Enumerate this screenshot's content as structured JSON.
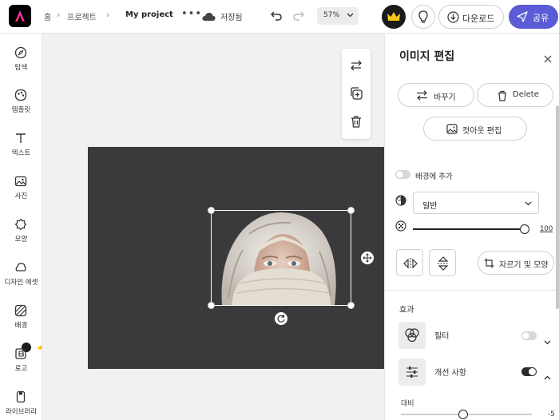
{
  "topbar": {
    "breadcrumb_home": "홈",
    "breadcrumb_projects": "프로젝트",
    "project_title": "My project",
    "more_label": "•••",
    "save_status": "저장됨",
    "zoom_level": "57%",
    "download_label": "다운로드",
    "share_label": "공유"
  },
  "sidebar": {
    "items": [
      {
        "label": "탐색",
        "icon": "explore-icon"
      },
      {
        "label": "템플릿",
        "icon": "template-icon"
      },
      {
        "label": "텍스트",
        "icon": "text-icon"
      },
      {
        "label": "사진",
        "icon": "photo-icon"
      },
      {
        "label": "모양",
        "icon": "shape-icon"
      },
      {
        "label": "디자인 에셋",
        "icon": "design-assets-icon"
      },
      {
        "label": "배경",
        "icon": "background-icon"
      },
      {
        "label": "로고",
        "icon": "logo-icon"
      },
      {
        "label": "라이브러리",
        "icon": "library-icon"
      }
    ]
  },
  "panel": {
    "title": "이미지 편집",
    "replace_label": "바꾸기",
    "delete_label": "Delete",
    "cutout_label": "컷아웃 편집",
    "add_to_background_label": "배경에 추가",
    "blend_mode_value": "일반",
    "opacity_value": "100",
    "crop_label": "자르기 및 모양",
    "effects_title": "효과",
    "filter_label": "필터",
    "filter_enabled": false,
    "adjustments_label": "개선 사항",
    "adjustments_enabled": true,
    "contrast_label": "대비",
    "contrast_value": "-5"
  },
  "colors": {
    "accent": "#5b5bd6",
    "artboard": "#3a3a3d",
    "workspace": "#f1f1f1",
    "crown": "#f5c518"
  }
}
